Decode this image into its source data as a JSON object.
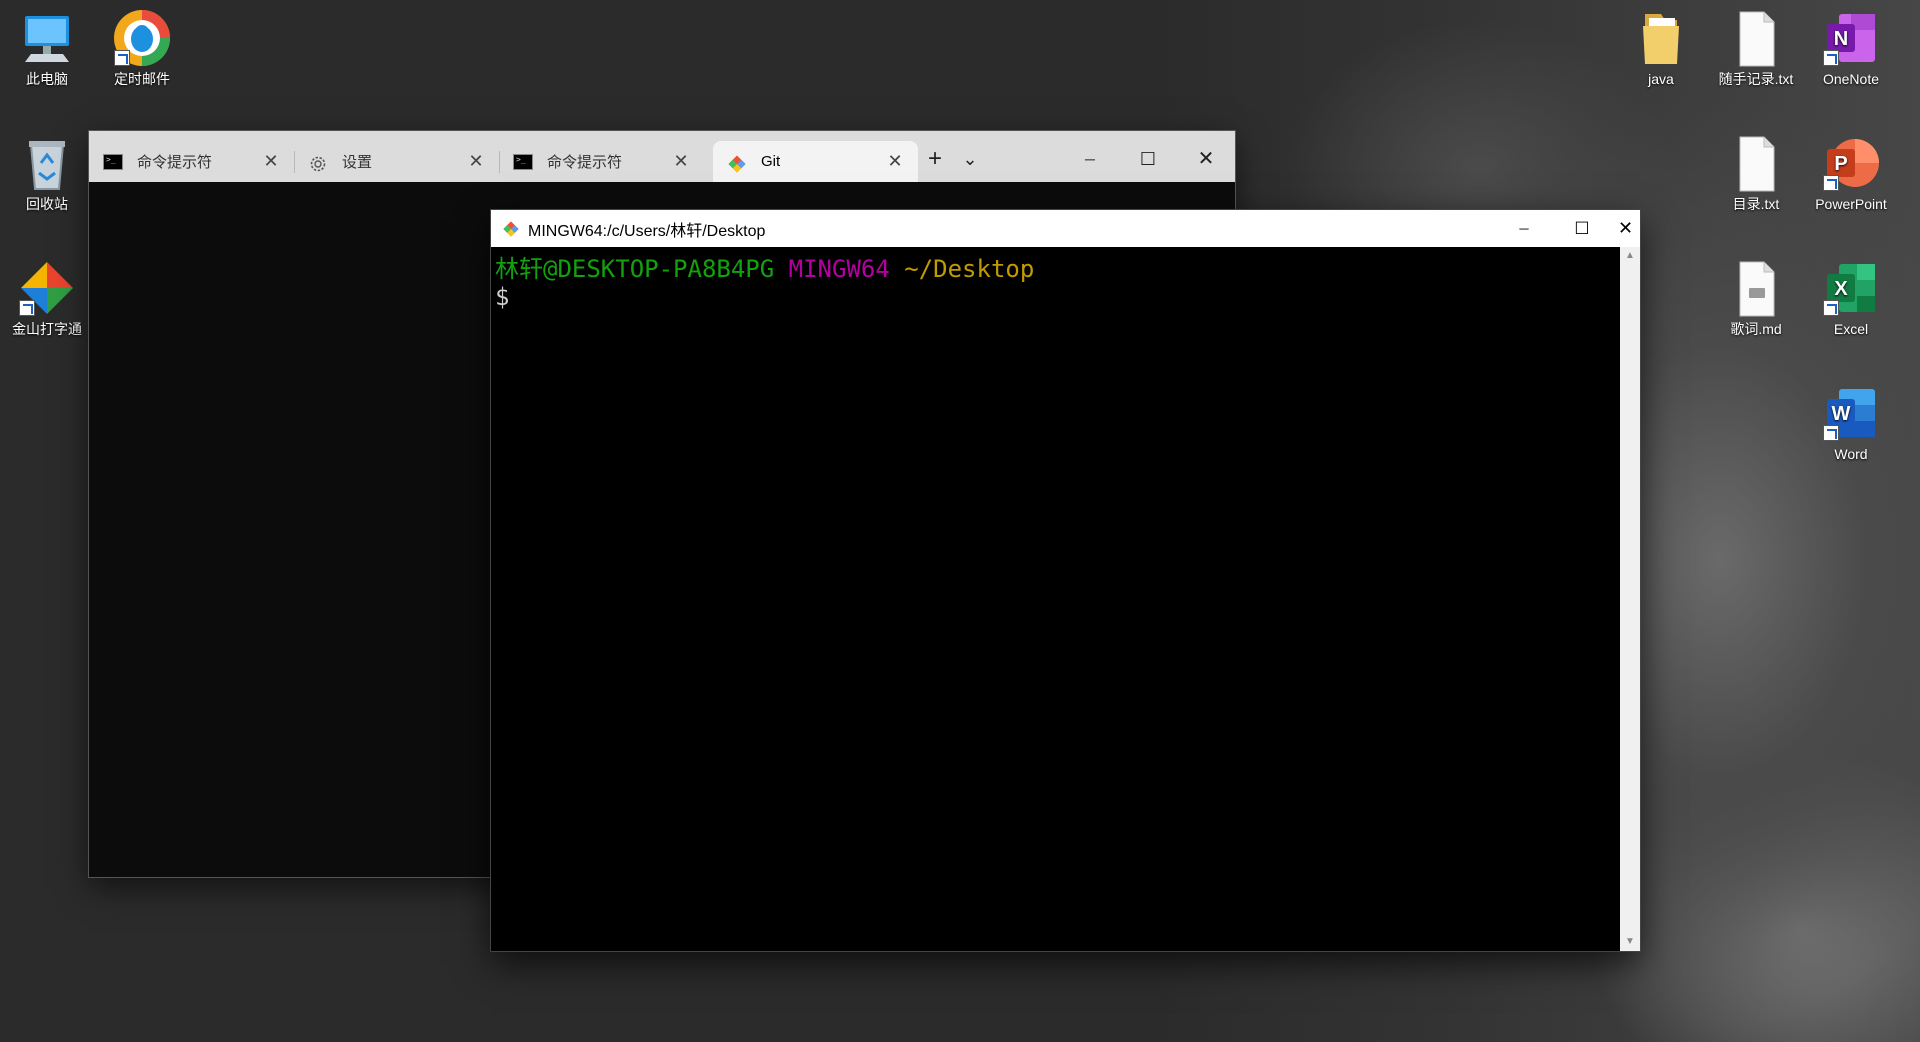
{
  "desktop": {
    "left_icons": [
      {
        "label": "此电脑",
        "icon": "computer-icon"
      },
      {
        "label": "定时邮件",
        "icon": "qq-mail-icon"
      },
      {
        "label": "回收站",
        "icon": "recycle-bin-icon"
      },
      {
        "label": "金山打字通",
        "icon": "typing-app-icon"
      }
    ],
    "right_icons": [
      {
        "label": "java",
        "icon": "folder-icon"
      },
      {
        "label": "随手记录.txt",
        "icon": "text-file-icon"
      },
      {
        "label": "OneNote",
        "icon": "onenote-icon",
        "letter": "N",
        "color": "#7719aa"
      },
      {
        "label": "目录.txt",
        "icon": "text-file-icon"
      },
      {
        "label": "PowerPoint",
        "icon": "powerpoint-icon",
        "letter": "P",
        "color": "#d24726"
      },
      {
        "label": "歌词.md",
        "icon": "markdown-file-icon"
      },
      {
        "label": "Excel",
        "icon": "excel-icon",
        "letter": "X",
        "color": "#1d6f42"
      },
      {
        "label": "Word",
        "icon": "word-icon",
        "letter": "W",
        "color": "#2b579a"
      }
    ]
  },
  "terminal_window": {
    "tabs": [
      {
        "label": "命令提示符",
        "icon": "cmd-icon",
        "active": false
      },
      {
        "label": "设置",
        "icon": "gear-icon",
        "active": false
      },
      {
        "label": "命令提示符",
        "icon": "cmd-icon",
        "active": false
      },
      {
        "label": "Git",
        "icon": "git-icon",
        "active": true
      }
    ],
    "new_tab_glyph": "+",
    "dropdown_glyph": "⌄",
    "minimize_glyph": "─",
    "maximize_glyph": "☐",
    "close_glyph": "✕",
    "tab_close_glyph": "✕"
  },
  "git_window": {
    "title": "MINGW64:/c/Users/林轩/Desktop",
    "minimize_glyph": "─",
    "maximize_glyph": "☐",
    "close_glyph": "✕",
    "prompt": {
      "user_host": "林轩@DESKTOP-PA8B4PG",
      "msystem": "MINGW64",
      "path": "~/Desktop",
      "symbol": "$"
    },
    "colors": {
      "user_host": "#13a10e",
      "msystem": "#b4009e",
      "path": "#c19c00"
    }
  }
}
